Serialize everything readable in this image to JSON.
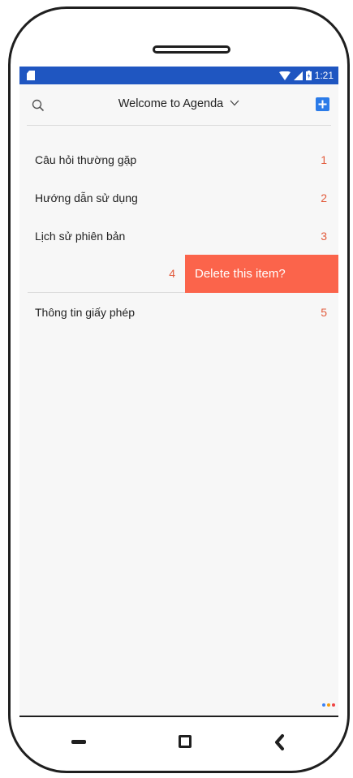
{
  "status_bar": {
    "time": "1:21"
  },
  "toolbar": {
    "title": "Welcome to Agenda",
    "search_icon": "search-icon",
    "add_icon": "plus-square-icon"
  },
  "list": {
    "items": [
      {
        "label": "Câu hỏi thường gặp",
        "number": "1"
      },
      {
        "label": "Hướng dẫn sử dụng",
        "number": "2"
      },
      {
        "label": "Lịch sử phiên bản",
        "number": "3"
      },
      {
        "label": "",
        "number": "4"
      },
      {
        "label": "Thông tin giấy phép",
        "number": "5"
      }
    ],
    "swipe_action": "Delete this item?"
  },
  "colors": {
    "status_bar": "#1f56c1",
    "accent_number": "#e25b3c",
    "delete": "#fb644b",
    "add_button": "#2b7be8",
    "dots": [
      "#3b82f6",
      "#f59e0b",
      "#ef4444"
    ]
  }
}
